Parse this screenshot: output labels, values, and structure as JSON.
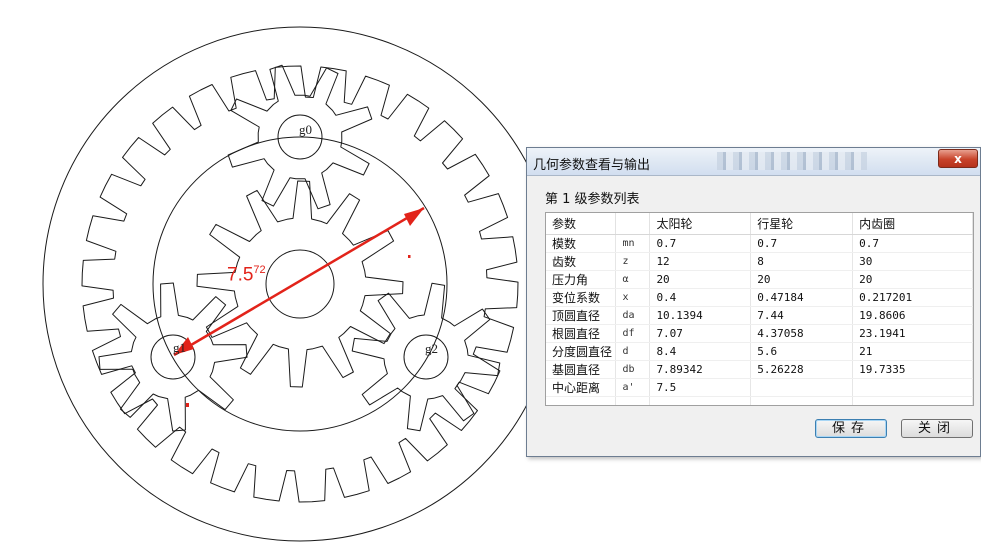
{
  "drawing": {
    "dimension_label": "7.5",
    "dimension_sub": "72",
    "gear_labels": [
      "g0",
      "g1",
      "g2"
    ],
    "colors": {
      "dimension": "#e2231a",
      "outline": "#1a1a1a"
    }
  },
  "dialog": {
    "title": "几何参数查看与输出",
    "close_glyph": "x",
    "section": "第 1 级参数列表",
    "columns": [
      "参数",
      "",
      "太阳轮",
      "行星轮",
      "内齿圈"
    ],
    "rows": [
      [
        "模数",
        "mn",
        "0.7",
        "0.7",
        "0.7"
      ],
      [
        "齿数",
        "z",
        "12",
        "8",
        "30"
      ],
      [
        "压力角",
        "α",
        "20",
        "20",
        "20"
      ],
      [
        "变位系数",
        "x",
        "0.4",
        "0.47184",
        "0.217201"
      ],
      [
        "顶圆直径",
        "da",
        "10.1394",
        "7.44",
        "19.8606"
      ],
      [
        "根圆直径",
        "df",
        "7.07",
        "4.37058",
        "23.1941"
      ],
      [
        "分度圆直径",
        "d",
        "8.4",
        "5.6",
        "21"
      ],
      [
        "基圆直径",
        "db",
        "7.89342",
        "5.26228",
        "19.7335"
      ],
      [
        "中心距离",
        "a'",
        "7.5",
        "",
        ""
      ],
      [
        "",
        "",
        "",
        "",
        ""
      ]
    ],
    "save_label": "保存",
    "close_label": "关闭"
  }
}
